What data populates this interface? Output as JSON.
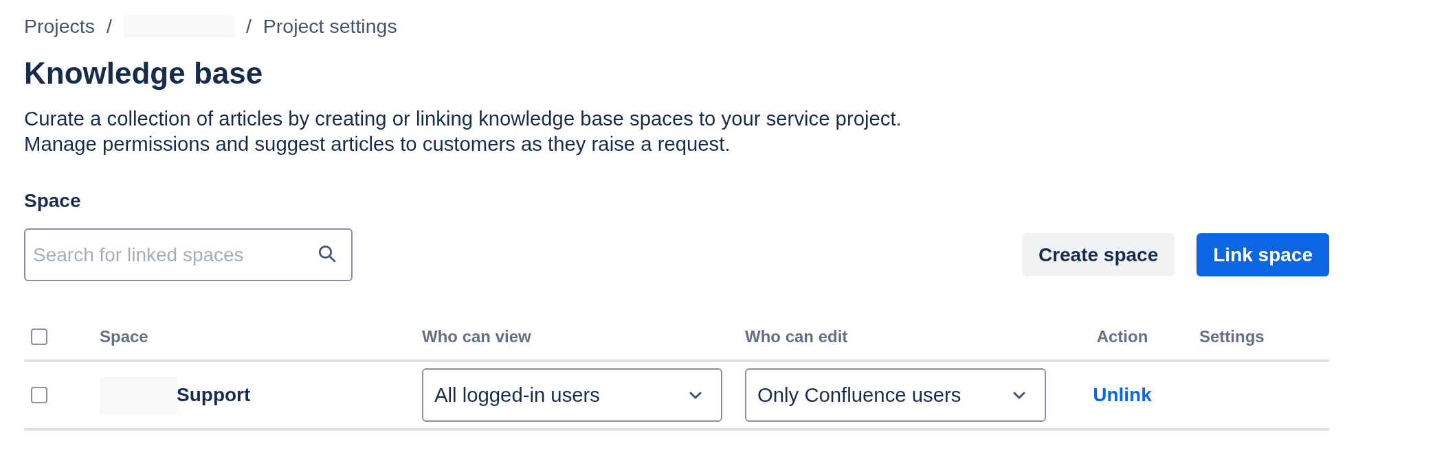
{
  "breadcrumbs": [
    {
      "kind": "link",
      "label": "Projects"
    },
    {
      "kind": "separator",
      "label": "/"
    },
    {
      "kind": "redacted"
    },
    {
      "kind": "separator",
      "label": "/"
    },
    {
      "kind": "link",
      "label": "Project settings"
    }
  ],
  "title": "Knowledge base",
  "description": [
    "Curate a collection of articles by creating or linking knowledge base spaces to your service project.",
    "Manage permissions and suggest articles to customers as they raise a request."
  ],
  "section_label": "Space",
  "search": {
    "placeholder": "Search for linked spaces"
  },
  "buttons": [
    {
      "kind": "default",
      "label": "Create space"
    },
    {
      "kind": "primary",
      "label": "Link space"
    }
  ],
  "table": {
    "select_all_checked": false,
    "columns": [
      "Space",
      "Who can view",
      "Who can edit",
      "Action",
      "Settings"
    ],
    "rows": [
      {
        "checked": false,
        "space": {
          "name": "Support",
          "redacted_prefix": true
        },
        "who_can_view": "All logged-in users",
        "who_can_edit": "Only Confluence users",
        "action": "Unlink"
      }
    ]
  }
}
